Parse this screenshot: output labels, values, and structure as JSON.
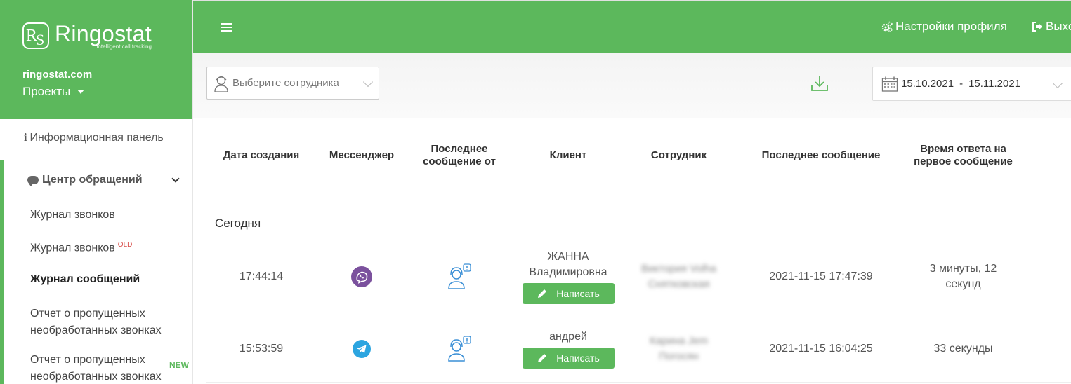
{
  "sidebar": {
    "logo_text": "Ringostat",
    "logo_mark_r": "R",
    "logo_mark_s": "S",
    "logo_tagline": "intelligent call tracking",
    "company": "ringostat.com",
    "projects_label": "Проекты",
    "info_panel": "Информационная панель",
    "section_title": "Центр обращений",
    "items": [
      {
        "label": "Журнал звонков",
        "badge": ""
      },
      {
        "label": "Журнал звонков",
        "badge": "OLD"
      },
      {
        "label": "Журнал сообщений",
        "badge": ""
      },
      {
        "label": "Отчет о пропущенных необработанных звонках",
        "badge": ""
      },
      {
        "label": "Отчет о пропущенных необработанных звонках",
        "badge": "NEW"
      }
    ]
  },
  "header": {
    "profile_settings": "Настройки профиля",
    "logout": "Выход"
  },
  "filters": {
    "employee_placeholder": "Выберите сотрудника",
    "date_from": "15.10.2021",
    "date_sep": "-",
    "date_to": "15.11.2021"
  },
  "table": {
    "columns": [
      "Дата создания",
      "Мессенджер",
      "Последнее сообщение от",
      "Клиент",
      "Сотрудник",
      "Последнее сообщение",
      "Время ответа на первое сообщение"
    ],
    "group_label": "Сегодня",
    "write_label": "Написать",
    "rows": [
      {
        "time": "17:44:14",
        "messenger": "viber-icon",
        "last_from": "operator-icon",
        "client": "ЖАННА Владимировна",
        "employee": "Виктория Volha Снятковская",
        "last_message": "2021-11-15 17:47:39",
        "response_time": "3 минуты, 12 секунд"
      },
      {
        "time": "15:53:59",
        "messenger": "telegram-icon",
        "last_from": "operator-icon",
        "client": "андрей",
        "employee": "Карина Jem Погосян",
        "last_message": "2021-11-15 16:04:25",
        "response_time": "33 секунды"
      }
    ]
  },
  "colors": {
    "brand_green": "#5cb85c",
    "viber_purple": "#7b519d",
    "telegram_blue": "#2ca5e0",
    "operator_blue": "#3a8fd6",
    "badge_red": "#d9534f"
  }
}
